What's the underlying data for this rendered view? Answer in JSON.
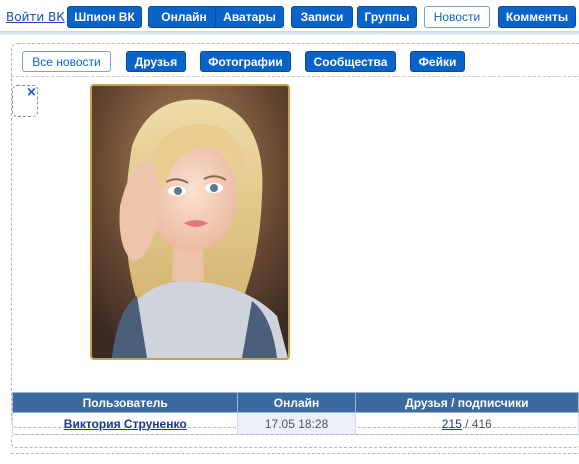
{
  "topnav": {
    "login_label": "Войти ВК",
    "items": [
      {
        "label": "Шпион ВК",
        "active": false
      },
      {
        "label": "Онлайн",
        "active": false
      },
      {
        "label": "Аватары",
        "active": false
      },
      {
        "label": "Записи",
        "active": false
      },
      {
        "label": "Группы",
        "active": false
      },
      {
        "label": "Новости",
        "active": true
      },
      {
        "label": "Комменты",
        "active": false
      }
    ]
  },
  "subnav": {
    "items": [
      {
        "label": "Все новости",
        "active": true
      },
      {
        "label": "Друзья",
        "active": false
      },
      {
        "label": "Фотографии",
        "active": false
      },
      {
        "label": "Сообщества",
        "active": false
      },
      {
        "label": "Фейки",
        "active": false
      }
    ]
  },
  "close_symbol": "×",
  "table": {
    "headers": [
      "Пользователь",
      "Онлайн",
      "Друзья / подписчики"
    ],
    "rows": [
      {
        "name": "Виктория Струненко",
        "online": "17.05 18:28",
        "friends": "215",
        "followers": "/ 416"
      }
    ]
  },
  "colors": {
    "accent": "#0a63c9",
    "header_bg": "#3b6aa0",
    "link": "#1a3a8a",
    "photo_border": "#c8a24a"
  }
}
